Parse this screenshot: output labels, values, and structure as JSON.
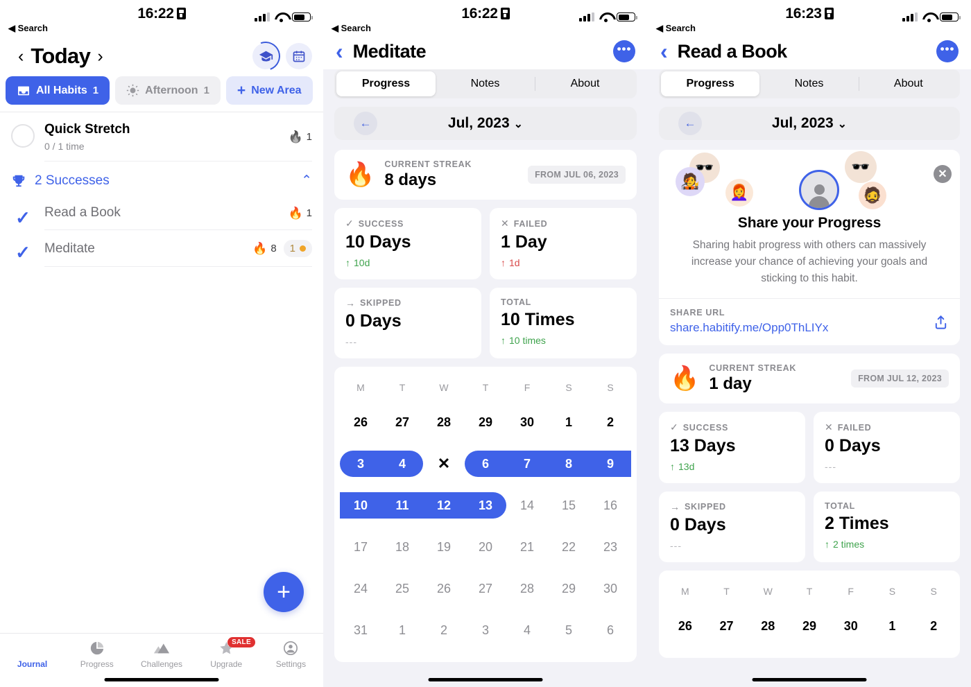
{
  "panels": [
    {
      "status": {
        "time": "16:22",
        "back": "Search",
        "lock_icon": "lock-portrait-icon"
      },
      "header": {
        "title": "Today",
        "prev_icon": "chevron-left-icon",
        "next_icon": "chevron-right-icon",
        "graduation_icon": "graduation-cap-icon",
        "calendar_icon": "calendar-icon"
      },
      "chips": [
        {
          "label": "All Habits",
          "count": "1",
          "icon": "inbox-icon",
          "state": "active"
        },
        {
          "label": "Afternoon",
          "count": "1",
          "icon": "sun-icon",
          "state": "plain"
        },
        {
          "label": "New Area",
          "count": "",
          "icon": "plus-icon",
          "state": "newarea"
        }
      ],
      "pending": [
        {
          "name": "Quick Stretch",
          "sub": "0 / 1 time",
          "streak": "1",
          "flame": "🔥",
          "flame_tone": "gray"
        }
      ],
      "section": {
        "icon": "trophy-icon",
        "label": "2 Successes",
        "caret": "chevron-up-icon"
      },
      "done": [
        {
          "name": "Read a Book",
          "streak": "1",
          "flame": "🔥",
          "badge": "",
          "badge_dot": false
        },
        {
          "name": "Meditate",
          "streak": "8",
          "flame": "🔥",
          "badge": "1",
          "badge_dot": true
        }
      ],
      "fab": {
        "icon": "plus-icon",
        "label": "+"
      },
      "tabs": [
        {
          "label": "Journal",
          "icon": "journal-icon",
          "selected": true,
          "badge": ""
        },
        {
          "label": "Progress",
          "icon": "pie-chart-icon",
          "selected": false,
          "badge": ""
        },
        {
          "label": "Challenges",
          "icon": "mountain-icon",
          "selected": false,
          "badge": ""
        },
        {
          "label": "Upgrade",
          "icon": "star-icon",
          "selected": false,
          "badge": "SALE"
        },
        {
          "label": "Settings",
          "icon": "account-icon",
          "selected": false,
          "badge": ""
        }
      ]
    },
    {
      "status": {
        "time": "16:22",
        "back": "Search",
        "lock_icon": "lock-portrait-icon"
      },
      "header": {
        "title": "Meditate",
        "back_icon": "chevron-left-icon",
        "more_icon": "more-horizontal-icon"
      },
      "segments": [
        {
          "label": "Progress",
          "on": true
        },
        {
          "label": "Notes",
          "on": false
        },
        {
          "label": "About",
          "on": false
        }
      ],
      "month": {
        "label": "Jul, 2023",
        "back_icon": "arrow-left-icon",
        "dropdown_icon": "chevron-down-icon"
      },
      "streak": {
        "caption": "CURRENT STREAK",
        "value": "8 days",
        "from": "FROM JUL 06, 2023",
        "flame": "🔥"
      },
      "stats": [
        {
          "icon": "check-icon",
          "caption": "SUCCESS",
          "value": "10 Days",
          "delta": "10d",
          "tone": "up"
        },
        {
          "icon": "close-icon",
          "caption": "FAILED",
          "value": "1 Day",
          "delta": "1d",
          "tone": "down"
        },
        {
          "icon": "arrow-right-icon",
          "caption": "SKIPPED",
          "value": "0 Days",
          "delta": "---",
          "tone": "none"
        },
        {
          "icon": "",
          "caption": "TOTAL",
          "value": "10 Times",
          "delta": "10 times",
          "tone": "up"
        }
      ],
      "calendar": {
        "dow": [
          "M",
          "T",
          "W",
          "T",
          "F",
          "S",
          "S"
        ],
        "weeks": [
          {
            "days": [
              {
                "n": "26",
                "state": "cur"
              },
              {
                "n": "27",
                "state": "cur"
              },
              {
                "n": "28",
                "state": "cur"
              },
              {
                "n": "29",
                "state": "cur"
              },
              {
                "n": "30",
                "state": "cur"
              },
              {
                "n": "1",
                "state": "cur"
              },
              {
                "n": "2",
                "state": "cur"
              }
            ]
          },
          {
            "days": [
              {
                "n": "3",
                "state": "on"
              },
              {
                "n": "4",
                "state": "on"
              },
              {
                "n": "✕",
                "state": "fail"
              },
              {
                "n": "6",
                "state": "on"
              },
              {
                "n": "7",
                "state": "on"
              },
              {
                "n": "8",
                "state": "on"
              },
              {
                "n": "9",
                "state": "on"
              }
            ],
            "runs": [
              {
                "start": 0,
                "end": 1,
                "round": "both"
              },
              {
                "start": 3,
                "end": 6,
                "round": "left"
              }
            ]
          },
          {
            "days": [
              {
                "n": "10",
                "state": "on"
              },
              {
                "n": "11",
                "state": "on"
              },
              {
                "n": "12",
                "state": "on"
              },
              {
                "n": "13",
                "state": "on"
              },
              {
                "n": "14",
                "state": "off"
              },
              {
                "n": "15",
                "state": "off"
              },
              {
                "n": "16",
                "state": "off"
              }
            ],
            "runs": [
              {
                "start": 0,
                "end": 3,
                "round": "right"
              }
            ]
          },
          {
            "days": [
              {
                "n": "17",
                "state": "off"
              },
              {
                "n": "18",
                "state": "off"
              },
              {
                "n": "19",
                "state": "off"
              },
              {
                "n": "20",
                "state": "off"
              },
              {
                "n": "21",
                "state": "off"
              },
              {
                "n": "22",
                "state": "off"
              },
              {
                "n": "23",
                "state": "off"
              }
            ]
          },
          {
            "days": [
              {
                "n": "24",
                "state": "off"
              },
              {
                "n": "25",
                "state": "off"
              },
              {
                "n": "26",
                "state": "off"
              },
              {
                "n": "27",
                "state": "off"
              },
              {
                "n": "28",
                "state": "off"
              },
              {
                "n": "29",
                "state": "off"
              },
              {
                "n": "30",
                "state": "off"
              }
            ]
          },
          {
            "days": [
              {
                "n": "31",
                "state": "off"
              },
              {
                "n": "1",
                "state": "off"
              },
              {
                "n": "2",
                "state": "off"
              },
              {
                "n": "3",
                "state": "off"
              },
              {
                "n": "4",
                "state": "off"
              },
              {
                "n": "5",
                "state": "off"
              },
              {
                "n": "6",
                "state": "off"
              }
            ]
          }
        ]
      }
    },
    {
      "status": {
        "time": "16:23",
        "back": "Search",
        "lock_icon": "lock-portrait-icon"
      },
      "header": {
        "title": "Read a Book",
        "back_icon": "chevron-left-icon",
        "more_icon": "more-horizontal-icon"
      },
      "segments": [
        {
          "label": "Progress",
          "on": true
        },
        {
          "label": "Notes",
          "on": false
        },
        {
          "label": "About",
          "on": false
        }
      ],
      "month": {
        "label": "Jul, 2023",
        "back_icon": "arrow-left-icon",
        "dropdown_icon": "chevron-down-icon"
      },
      "share": {
        "title": "Share your Progress",
        "desc": "Sharing habit progress with others can massively increase your chance of achieving your goals and sticking to this habit.",
        "url_caption": "SHARE URL",
        "url": "share.habitify.me/Opp0ThLIYx",
        "share_icon": "share-upload-icon",
        "close_icon": "close-circle-icon",
        "avatars": [
          "🧑‍🎤",
          "👩‍🦰",
          "person-placeholder",
          "🧔",
          "🕶️",
          "🕶️"
        ]
      },
      "streak": {
        "caption": "CURRENT STREAK",
        "value": "1 day",
        "from": "FROM JUL 12, 2023",
        "flame": "🔥"
      },
      "stats": [
        {
          "icon": "check-icon",
          "caption": "SUCCESS",
          "value": "13 Days",
          "delta": "13d",
          "tone": "up"
        },
        {
          "icon": "close-icon",
          "caption": "FAILED",
          "value": "0 Days",
          "delta": "---",
          "tone": "none"
        },
        {
          "icon": "arrow-right-icon",
          "caption": "SKIPPED",
          "value": "0 Days",
          "delta": "---",
          "tone": "none"
        },
        {
          "icon": "",
          "caption": "TOTAL",
          "value": "2 Times",
          "delta": "2 times",
          "tone": "up"
        }
      ],
      "calendar": {
        "dow": [
          "M",
          "T",
          "W",
          "T",
          "F",
          "S",
          "S"
        ],
        "weeks": [
          {
            "days": [
              {
                "n": "26",
                "state": "cur"
              },
              {
                "n": "27",
                "state": "cur"
              },
              {
                "n": "28",
                "state": "cur"
              },
              {
                "n": "29",
                "state": "cur"
              },
              {
                "n": "30",
                "state": "cur"
              },
              {
                "n": "1",
                "state": "cur"
              },
              {
                "n": "2",
                "state": "cur"
              }
            ]
          }
        ]
      }
    }
  ],
  "colors": {
    "accent": "#3f62e8",
    "flame": "#d9622b",
    "success": "#3fa34d",
    "danger": "#d94a4a",
    "sale": "#e03131",
    "badge_gold": "#f0a52a",
    "bg": "#f2f2f7"
  }
}
